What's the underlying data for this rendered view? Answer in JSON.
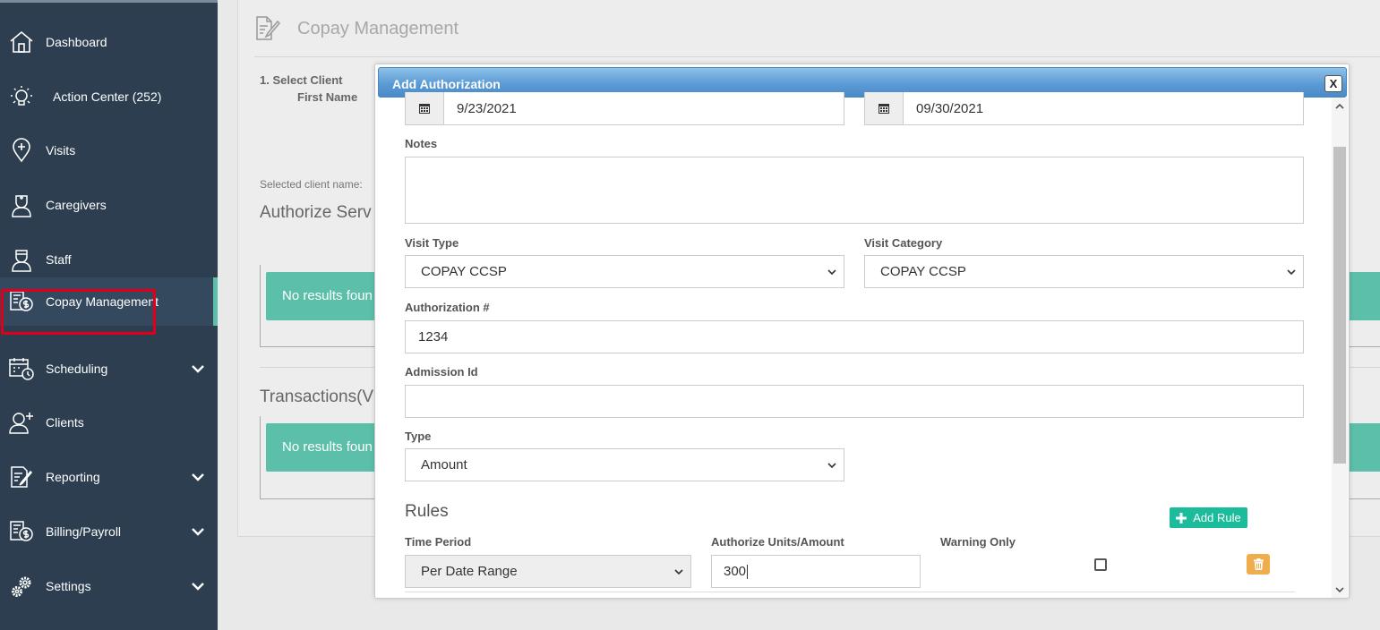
{
  "sidebar": {
    "items": [
      {
        "label": "Dashboard",
        "icon": "home-icon"
      },
      {
        "label": "Action Center (252)",
        "icon": "lightbulb-icon"
      },
      {
        "label": "Visits",
        "icon": "map-pin-plus-icon"
      },
      {
        "label": "Caregivers",
        "icon": "nurse-icon"
      },
      {
        "label": "Staff",
        "icon": "staff-icon"
      },
      {
        "label": "Copay Management",
        "icon": "copay-icon"
      },
      {
        "label": "Scheduling",
        "icon": "calendar-clock-icon"
      },
      {
        "label": "Clients",
        "icon": "add-user-icon"
      },
      {
        "label": "Reporting",
        "icon": "report-edit-icon"
      },
      {
        "label": "Billing/Payroll",
        "icon": "billing-icon"
      },
      {
        "label": "Settings",
        "icon": "gears-icon"
      }
    ],
    "active_item": "Copay Management",
    "accent_color": "#5bbfa9",
    "highlight_color": "#e0001b"
  },
  "page": {
    "title": "Copay Management",
    "select_client_label": "1. Select Client",
    "first_name_label": "First Name",
    "selected_client_label": "Selected client name:",
    "authorize_services_title": "Authorize Serv",
    "transactions_title": "Transactions(V",
    "no_results_1": "No results foun",
    "no_results_2": "No results foun"
  },
  "modal": {
    "title": "Add Authorization",
    "close_label": "X",
    "start_date": "9/23/2021",
    "end_date": "09/30/2021",
    "notes_label": "Notes",
    "notes_value": "",
    "visit_type_label": "Visit Type",
    "visit_type_value": "COPAY CCSP",
    "visit_category_label": "Visit Category",
    "visit_category_value": "COPAY CCSP",
    "authorization_label": "Authorization #",
    "authorization_value": "1234",
    "admission_label": "Admission Id",
    "admission_value": "",
    "type_label": "Type",
    "type_value": "Amount",
    "rules_title": "Rules",
    "add_rule_label": "Add Rule",
    "time_period_label": "Time Period",
    "time_period_value": "Per Date Range",
    "authorize_units_label": "Authorize Units/Amount",
    "authorize_units_value": "300",
    "warning_only_label": "Warning Only",
    "warning_only_checked": false
  }
}
